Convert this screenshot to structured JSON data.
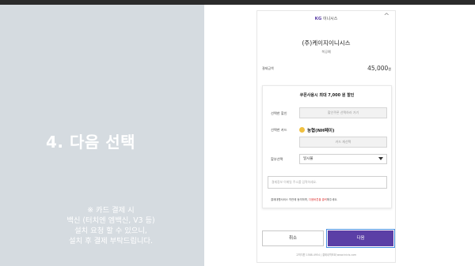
{
  "slide": {
    "step_title": "4. 다음 선택",
    "note_lines": [
      "※ 카드 결제 시",
      "백신 (터치엔 엠백신, V3 등)",
      "설치 요청 할 수 있으니,",
      "설치 후 결제 부탁드립니다."
    ]
  },
  "payment": {
    "close_icon": "close-icon",
    "logo_kg": "KG",
    "logo_text": "이니시스",
    "merchant_name": "(주)케이지이니시스",
    "merchant_sub": "복공예",
    "amount_label": "결제금액",
    "amount_value": "45,000",
    "amount_unit": "원",
    "coupon_title": "쿠폰사용시 최대 7,000 원 할인",
    "discount_label": "선택한 할인",
    "discount_button": "할인쿠폰 선택하러 가기",
    "card_label": "선택한 카드",
    "card_name": "농협(NH페이)",
    "card_reselect": "카드 재선택",
    "installment_label": "할부선택",
    "installment_value": "일시불",
    "email_placeholder": "결제정보 이메일 주소를 입력하세요.",
    "agree_prefix": "결제대행서비스 약관에 동의하며, ",
    "agree_link": "다음버튼을 클릭",
    "agree_suffix": "해주세요.",
    "cancel_label": "취소",
    "next_label": "다음",
    "footer": "고객지원 1588-4954 | 결제내역조회 www.inicis.com"
  },
  "colors": {
    "accent": "#5b3fa6",
    "left_panel": "#d5dbe0",
    "focus": "#4a90e2"
  }
}
